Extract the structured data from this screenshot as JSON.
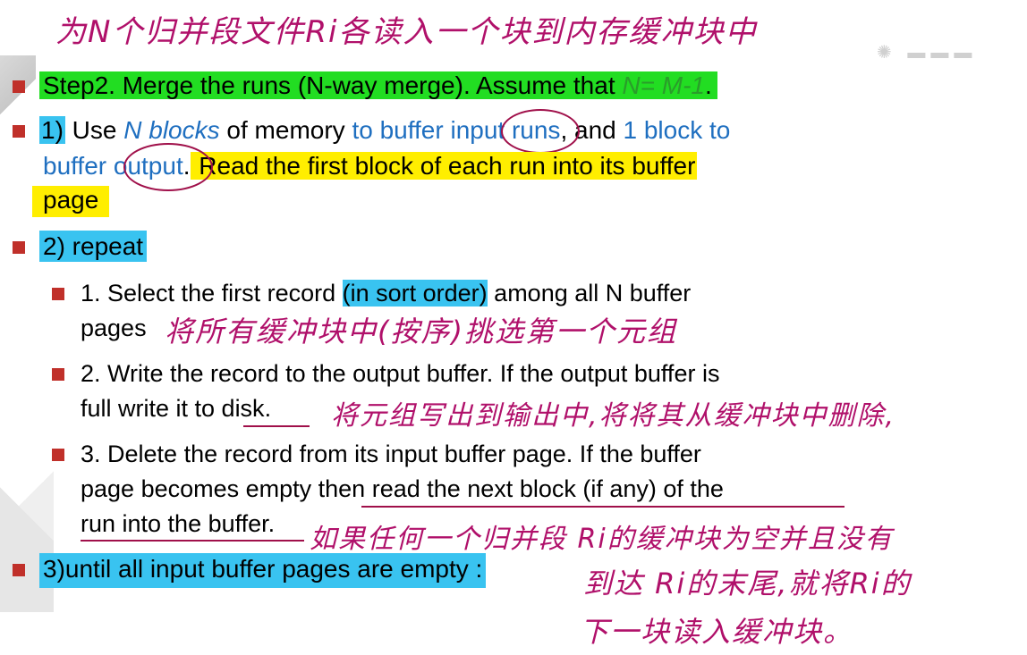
{
  "handwriting": {
    "top": "为N个归并段文件Ri各读入一个块到内存缓冲块中",
    "sub1": "将所有缓冲块中(按序)挑选第一个元组",
    "sub2": "将元组写出到输出中,将将其从缓冲块中删除,",
    "sub3_line1": "如果任何一个归并段 Ri的缓冲块为空并且没有",
    "sub3_line2": "到达 Ri的末尾,就将Ri的",
    "sub3_line3": "下一块读入缓冲块。"
  },
  "slide": {
    "step2": {
      "prefix": "Step2. Merge the runs (N-way merge). Assume that ",
      "formula": "N= M-1",
      "suffix": "."
    },
    "item1": {
      "num": "1)",
      "use": " Use ",
      "nblocks": "N blocks",
      "of_memory": " of memory ",
      "to_buffer": "to buffer ",
      "input": "input",
      "runs": " runs",
      "and": ", and ",
      "one_block": "1 block to",
      "buffer_output": "buffer output",
      "dot": ".",
      "read": " Read the first block of each run into its buffer",
      "page": "page"
    },
    "item2": {
      "label": "2) repeat"
    },
    "sub1": {
      "a": "1. Select the first record ",
      "b": "(in sort order)",
      "c": " among all N buffer",
      "d": "pages"
    },
    "sub2": {
      "a": "2. Write the record to the output buffer. If the output buffer is",
      "b": "full write it to ",
      "c": "disk",
      "d": "."
    },
    "sub3": {
      "a": "3. Delete the record from its input buffer page. If the buffer",
      "b": "page becomes empty then ",
      "c": "read the next block (if any) of the",
      "d": "run into the buffer",
      "e": "."
    },
    "item3": {
      "label": "3)until all input buffer pages are empty :"
    }
  }
}
